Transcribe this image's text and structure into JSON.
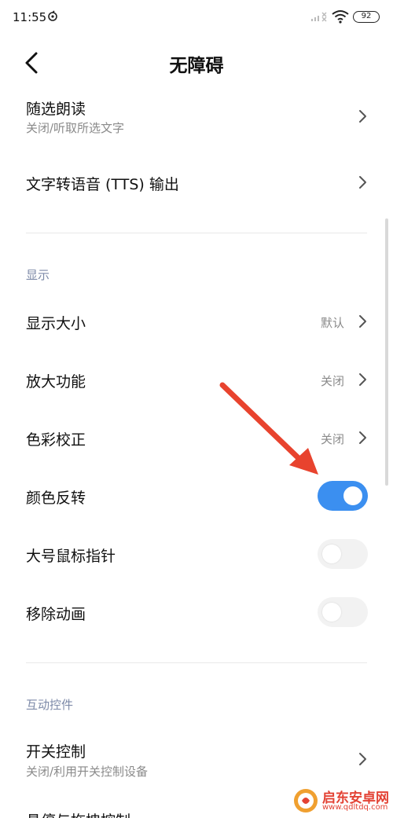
{
  "status_bar": {
    "time": "11:55",
    "battery": "92",
    "icons": [
      "netease-music-icon",
      "signal-off-icon",
      "wifi-icon",
      "battery-icon"
    ]
  },
  "header": {
    "title": "无障碍",
    "back_icon": "back-arrow-icon"
  },
  "rows_top": [
    {
      "title": "随选朗读",
      "subtitle": "关闭/听取所选文字"
    },
    {
      "title": "文字转语音 (TTS) 输出"
    }
  ],
  "display_section": {
    "label": "显示",
    "rows": [
      {
        "title": "显示大小",
        "value": "默认"
      },
      {
        "title": "放大功能",
        "value": "关闭"
      },
      {
        "title": "色彩校正",
        "value": "关闭"
      }
    ],
    "toggles": [
      {
        "title": "颜色反转",
        "on": true
      },
      {
        "title": "大号鼠标指针",
        "on": false
      },
      {
        "title": "移除动画",
        "on": false
      }
    ]
  },
  "interaction_section": {
    "label": "互动控件",
    "rows": [
      {
        "title": "开关控制",
        "subtitle": "关闭/利用开关控制设备"
      }
    ],
    "partial_row": "悬停与拖拽控制"
  },
  "watermark": {
    "name": "启东安卓网",
    "url": "www.qdltdq.com"
  },
  "colors": {
    "accent": "#3b8ff0",
    "arrow": "#e8432e",
    "section_label": "#7d8aa8"
  }
}
